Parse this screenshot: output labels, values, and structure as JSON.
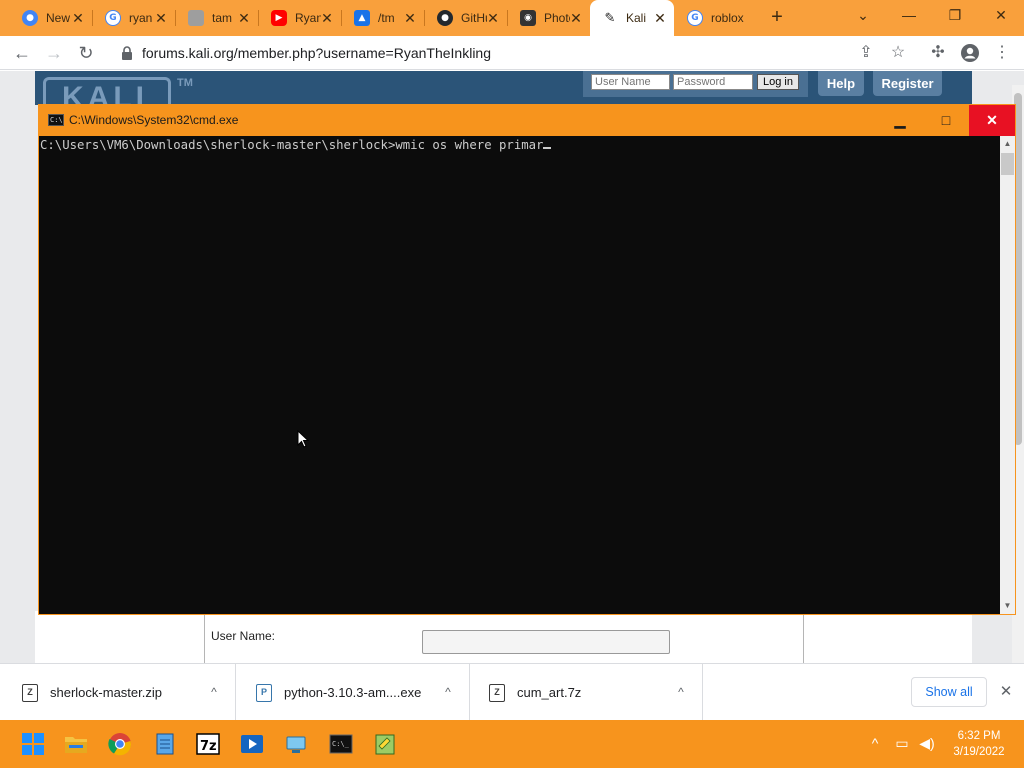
{
  "browser": {
    "tabs": [
      {
        "title": "New",
        "favicon": "chrome-icon",
        "color": "#4285f4"
      },
      {
        "title": "ryan",
        "favicon": "google-icon",
        "color": "#4285f4"
      },
      {
        "title": "tam",
        "favicon": "thumbnail-icon",
        "color": "#9e9e9e"
      },
      {
        "title": "Ryan",
        "favicon": "youtube-icon",
        "color": "#ff0000"
      },
      {
        "title": "/tm",
        "favicon": "cloud-icon",
        "color": "#1a73e8"
      },
      {
        "title": "GitHub",
        "favicon": "github-icon",
        "color": "#24292e"
      },
      {
        "title": "Photo",
        "favicon": "camera-icon",
        "color": "#333333"
      },
      {
        "title": "Kali",
        "favicon": "kali-dragon-icon",
        "color": "#222222",
        "active": true
      },
      {
        "title": "roblox",
        "favicon": "google-icon",
        "color": "#4285f4"
      }
    ],
    "tab_close_glyph": "✕",
    "new_tab_glyph": "+",
    "window_controls": {
      "dropdown": "⌄",
      "minimize": "—",
      "restore": "❐",
      "close": "✕"
    },
    "url": "forums.kali.org/member.php?username=RyanTheInkling",
    "nav": {
      "back": "←",
      "forward": "→",
      "reload": "↻"
    }
  },
  "webpage": {
    "logo_text": "KALI",
    "tm": "TM",
    "login": {
      "username_placeholder": "User Name",
      "password_placeholder": "Password",
      "login_button": "Log in"
    },
    "help_button": "Help",
    "register_button": "Register",
    "form": {
      "user_name_label": "User Name:"
    }
  },
  "cmd": {
    "title": "C:\\Windows\\System32\\cmd.exe",
    "prompt": "C:\\Users\\VM6\\Downloads\\sherlock-master\\sherlock>",
    "command": "wmic os where primar",
    "buttons": {
      "minimize": "▁",
      "maximize": "□",
      "close": "✕"
    }
  },
  "downloads": {
    "items": [
      {
        "name": "sherlock-master.zip",
        "icon": "zip-archive-icon"
      },
      {
        "name": "python-3.10.3-am....exe",
        "icon": "python-installer-icon"
      },
      {
        "name": "cum_art.7z",
        "icon": "7z-archive-icon"
      }
    ],
    "show_all": "Show all",
    "close": "✕",
    "chevron": "^"
  },
  "taskbar": {
    "apps": [
      "windows-start-icon",
      "file-explorer-icon",
      "chrome-icon",
      "notepad-icon",
      "7zip-icon",
      "media-player-icon",
      "network-icon",
      "cmd-icon",
      "notepad-plus-icon"
    ],
    "time": "6:32 PM",
    "date": "3/19/2022",
    "accent": "#f7941d"
  }
}
